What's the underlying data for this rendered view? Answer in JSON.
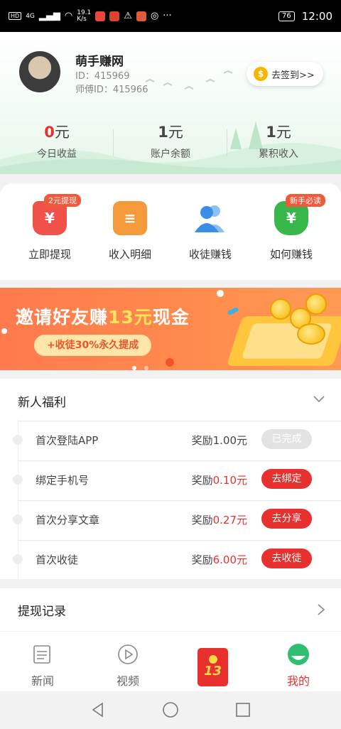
{
  "statusbar": {
    "chip_hd": "HD",
    "network": "4G",
    "speed": "19.1\nK/s",
    "battery": "76",
    "time": "12:00"
  },
  "profile": {
    "name": "萌手赚网",
    "id_text": "ID：415969",
    "master_id_text": "师傅ID：415966",
    "checkin_label": "去签到>>",
    "coin_symbol": "$"
  },
  "stats": [
    {
      "value": "0",
      "unit": "元",
      "label": "今日收益",
      "color": "#e8312f"
    },
    {
      "value": "1",
      "unit": "元",
      "label": "账户余额",
      "color": "#444444"
    },
    {
      "value": "1",
      "unit": "元",
      "label": "累积收入",
      "color": "#444444"
    }
  ],
  "shortcuts": [
    {
      "label": "立即提现",
      "icon": "withdraw-icon",
      "tag": "2元提现",
      "color": "#f0524a"
    },
    {
      "label": "收入明细",
      "icon": "income-detail-icon",
      "tag": "",
      "color": "#f59a3a"
    },
    {
      "label": "收徒赚钱",
      "icon": "recruit-icon",
      "tag": "",
      "color": "#3a8ee8"
    },
    {
      "label": "如何赚钱",
      "icon": "money-bag-icon",
      "tag": "新手必读",
      "color": "#38b84a"
    }
  ],
  "banner": {
    "title_pre": "邀请好友赚",
    "title_hl": "13元",
    "title_post": "现金",
    "pill": "+收徒30%永久提成"
  },
  "benefits": {
    "title": "新人福利",
    "reward_prefix": "奖励",
    "tasks": [
      {
        "name": "首次登陆APP",
        "amount": "1.00元",
        "button": "已完成",
        "done": true
      },
      {
        "name": "绑定手机号",
        "amount": "0.10元",
        "button": "去绑定",
        "done": false
      },
      {
        "name": "首次分享文章",
        "amount": "0.27元",
        "button": "去分享",
        "done": false
      },
      {
        "name": "首次收徒",
        "amount": "6.00元",
        "button": "去收徒",
        "done": false
      }
    ]
  },
  "records": {
    "title": "提现记录"
  },
  "bottomnav": {
    "news": "新闻",
    "video": "视频",
    "redpack_count": "13",
    "mine": "我的",
    "active_color": "#e8312f"
  }
}
